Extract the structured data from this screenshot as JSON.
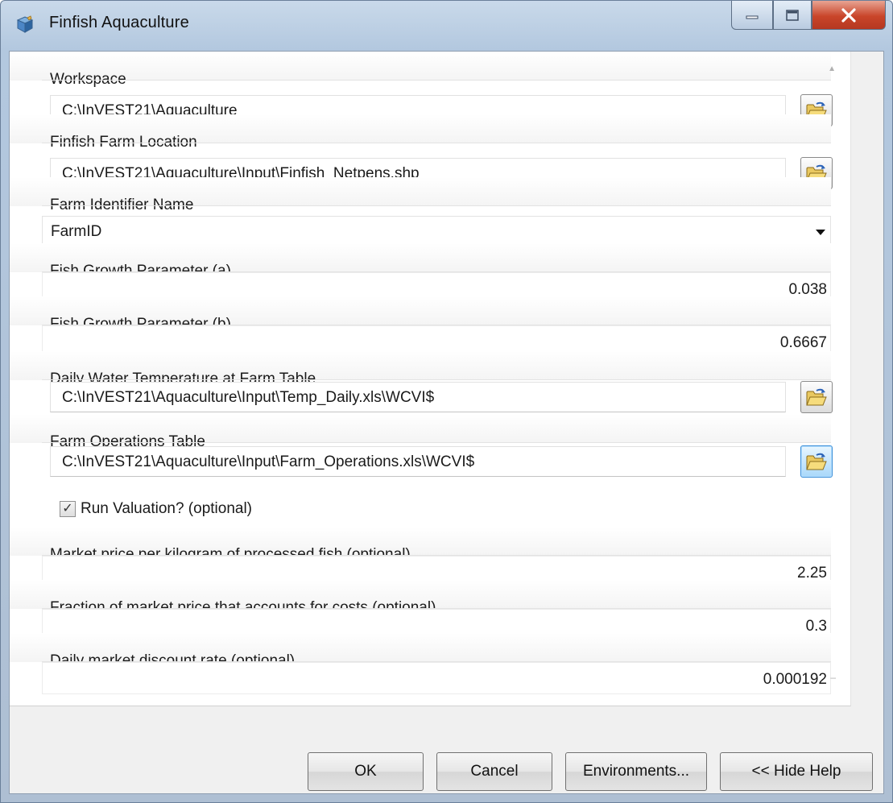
{
  "window": {
    "title": "Finfish Aquaculture"
  },
  "fields": {
    "workspace": {
      "label": "Workspace",
      "value": "C:\\InVEST21\\Aquaculture"
    },
    "farm_location": {
      "label": "Finfish Farm Location",
      "value": "C:\\InVEST21\\Aquaculture\\Input\\Finfish_Netpens.shp"
    },
    "farm_identifier": {
      "label": "Farm Identifier Name",
      "value": "FarmID"
    },
    "growth_a": {
      "label": "Fish Growth Parameter (a)",
      "value": "0.038"
    },
    "growth_b": {
      "label": "Fish Growth Parameter (b)",
      "value": "0.6667"
    },
    "water_temp": {
      "label": "Daily Water Temperature at Farm Table",
      "value": "C:\\InVEST21\\Aquaculture\\Input\\Temp_Daily.xls\\WCVI$"
    },
    "farm_operations": {
      "label": "Farm Operations Table",
      "value": "C:\\InVEST21\\Aquaculture\\Input\\Farm_Operations.xls\\WCVI$"
    },
    "run_valuation": {
      "label": "Run Valuation? (optional)",
      "checked": true,
      "mark": "✓"
    },
    "market_price": {
      "label": "Market price per kilogram of processed fish (optional)",
      "value": "2.25"
    },
    "cost_fraction": {
      "label": "Fraction of market price that accounts for costs (optional)",
      "value": "0.3"
    },
    "discount_rate": {
      "label": "Daily market discount rate (optional)",
      "value": "0.000192"
    }
  },
  "buttons": {
    "ok": "OK",
    "cancel": "Cancel",
    "environments": "Environments...",
    "hide_help": "<< Hide Help"
  },
  "icons": {
    "app": "toolbox-icon",
    "browse": "open-folder-icon",
    "minimize": "minimize-icon",
    "maximize": "maximize-icon",
    "close": "close-icon"
  },
  "colors": {
    "title_bar": "#b3c8df",
    "close_button": "#c9452a",
    "active_browse": "#a9d8fa"
  }
}
